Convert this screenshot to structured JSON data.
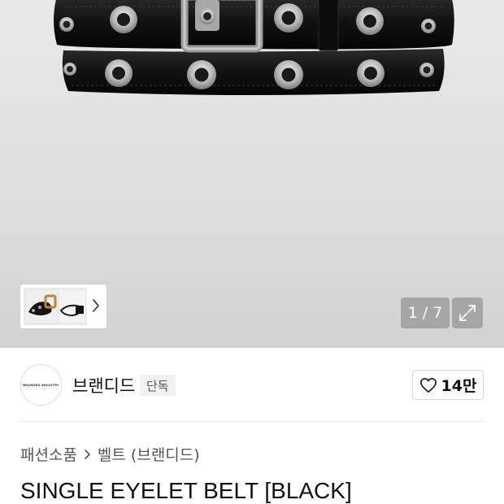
{
  "gallery": {
    "current_page": "1",
    "separator": "/",
    "total_pages": "7"
  },
  "brand": {
    "logo_text": "BRANDED INDUSTRY",
    "name": "브랜디드",
    "badge": "단독",
    "like_count": "14만"
  },
  "breadcrumb": {
    "category": "패션소품",
    "subcategory": "벨트 (브랜디드)"
  },
  "product": {
    "title": "SINGLE EYELET BELT [BLACK]"
  },
  "icons": {
    "thumb_next": "chevron-right-icon",
    "expand": "expand-icon",
    "like": "heart-icon",
    "breadcrumb_sep": "chevron-right-icon"
  }
}
